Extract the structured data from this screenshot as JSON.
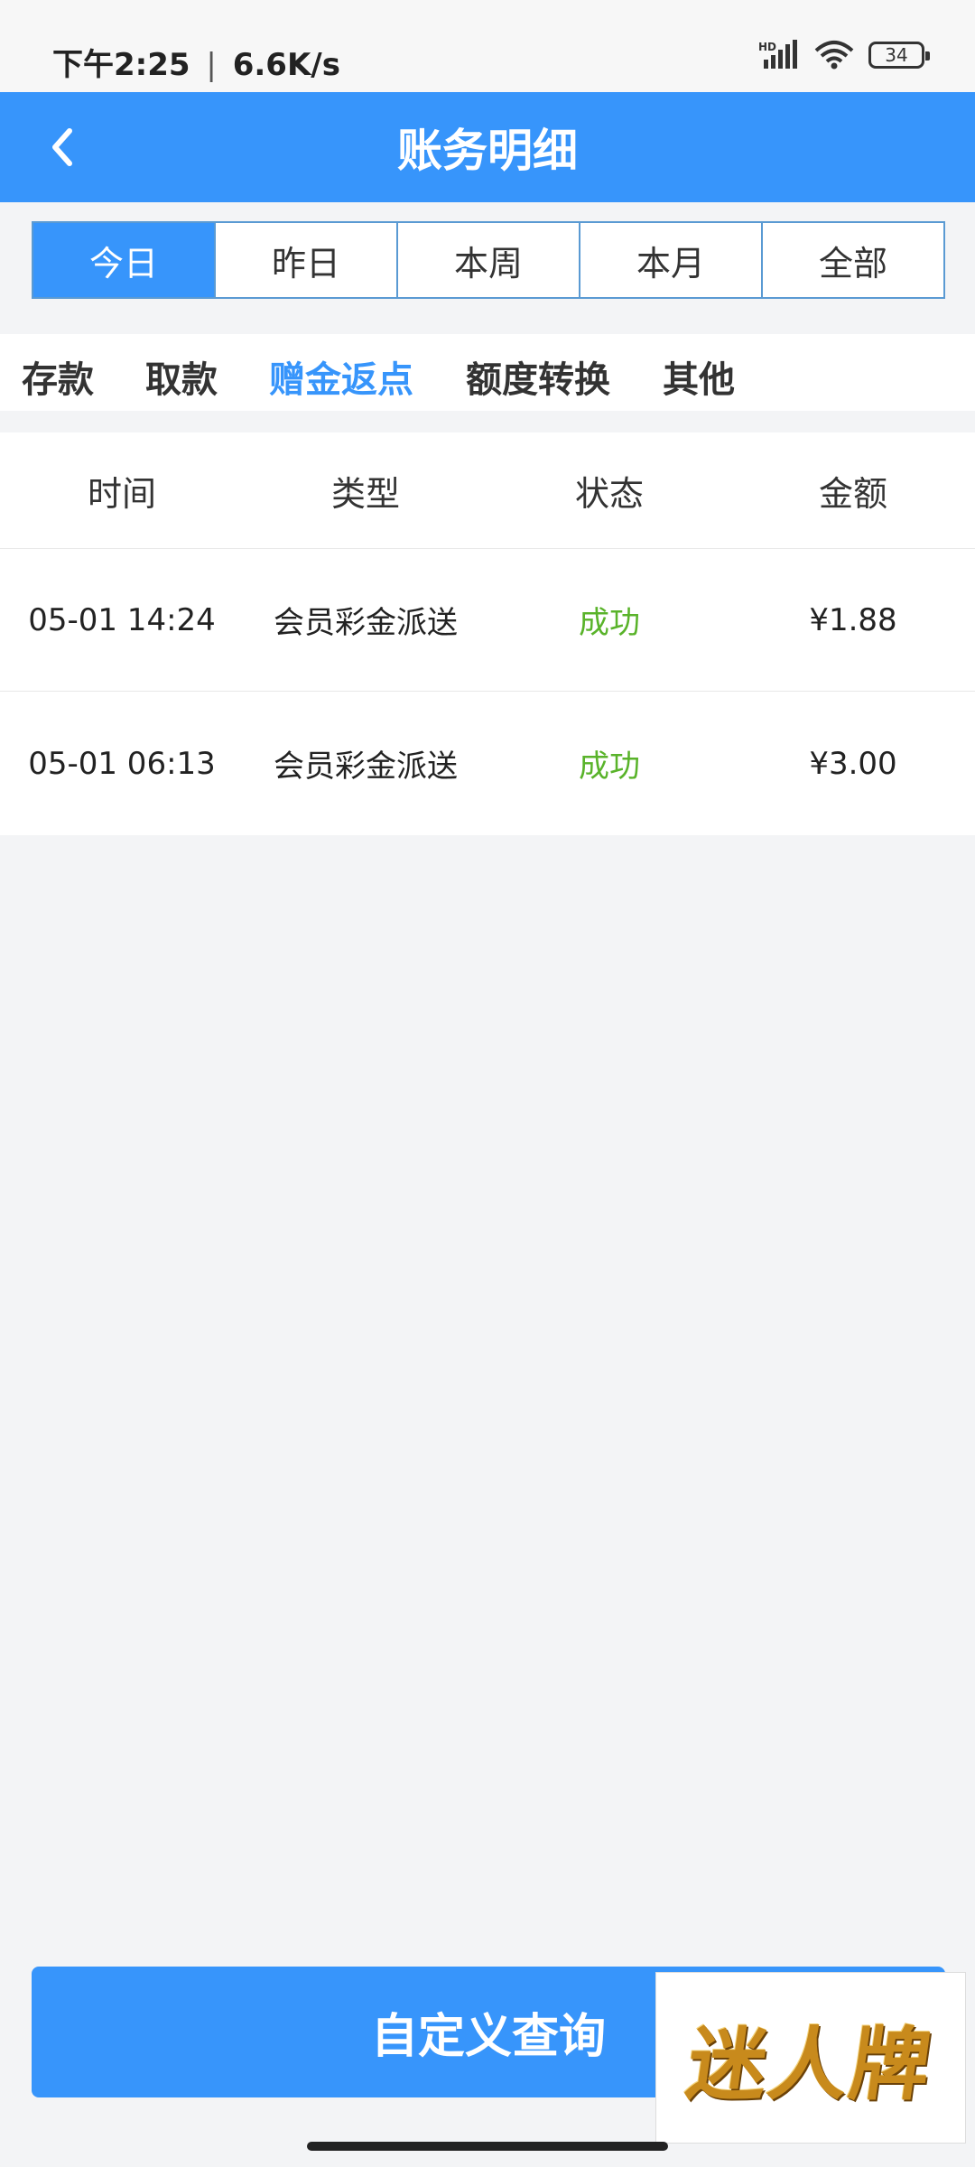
{
  "status_bar": {
    "time": "下午2:25",
    "separator": "|",
    "speed": "6.6K/s",
    "battery": "34",
    "icons": [
      "hd-signal-icon",
      "wifi-icon",
      "battery-icon"
    ]
  },
  "header": {
    "title": "账务明细",
    "back_icon": "chevron-left-icon"
  },
  "date_filter": {
    "items": [
      "今日",
      "昨日",
      "本周",
      "本月",
      "全部"
    ],
    "selected": "今日"
  },
  "category_tabs": {
    "items": [
      "存款",
      "取款",
      "赠金返点",
      "额度转换",
      "其他"
    ],
    "selected": "赠金返点"
  },
  "table": {
    "headers": [
      "时间",
      "类型",
      "状态",
      "金额"
    ],
    "rows": [
      {
        "time": "05-01 14:24",
        "type": "会员彩金派送",
        "status": "成功",
        "amount": "¥1.88"
      },
      {
        "time": "05-01 06:13",
        "type": "会员彩金派送",
        "status": "成功",
        "amount": "¥3.00"
      }
    ]
  },
  "footer": {
    "query_button": "自定义查询"
  },
  "watermark": {
    "text": "迷人牌"
  },
  "colors": {
    "primary": "#3795fb",
    "success": "#59b32a",
    "background": "#f3f4f6"
  }
}
